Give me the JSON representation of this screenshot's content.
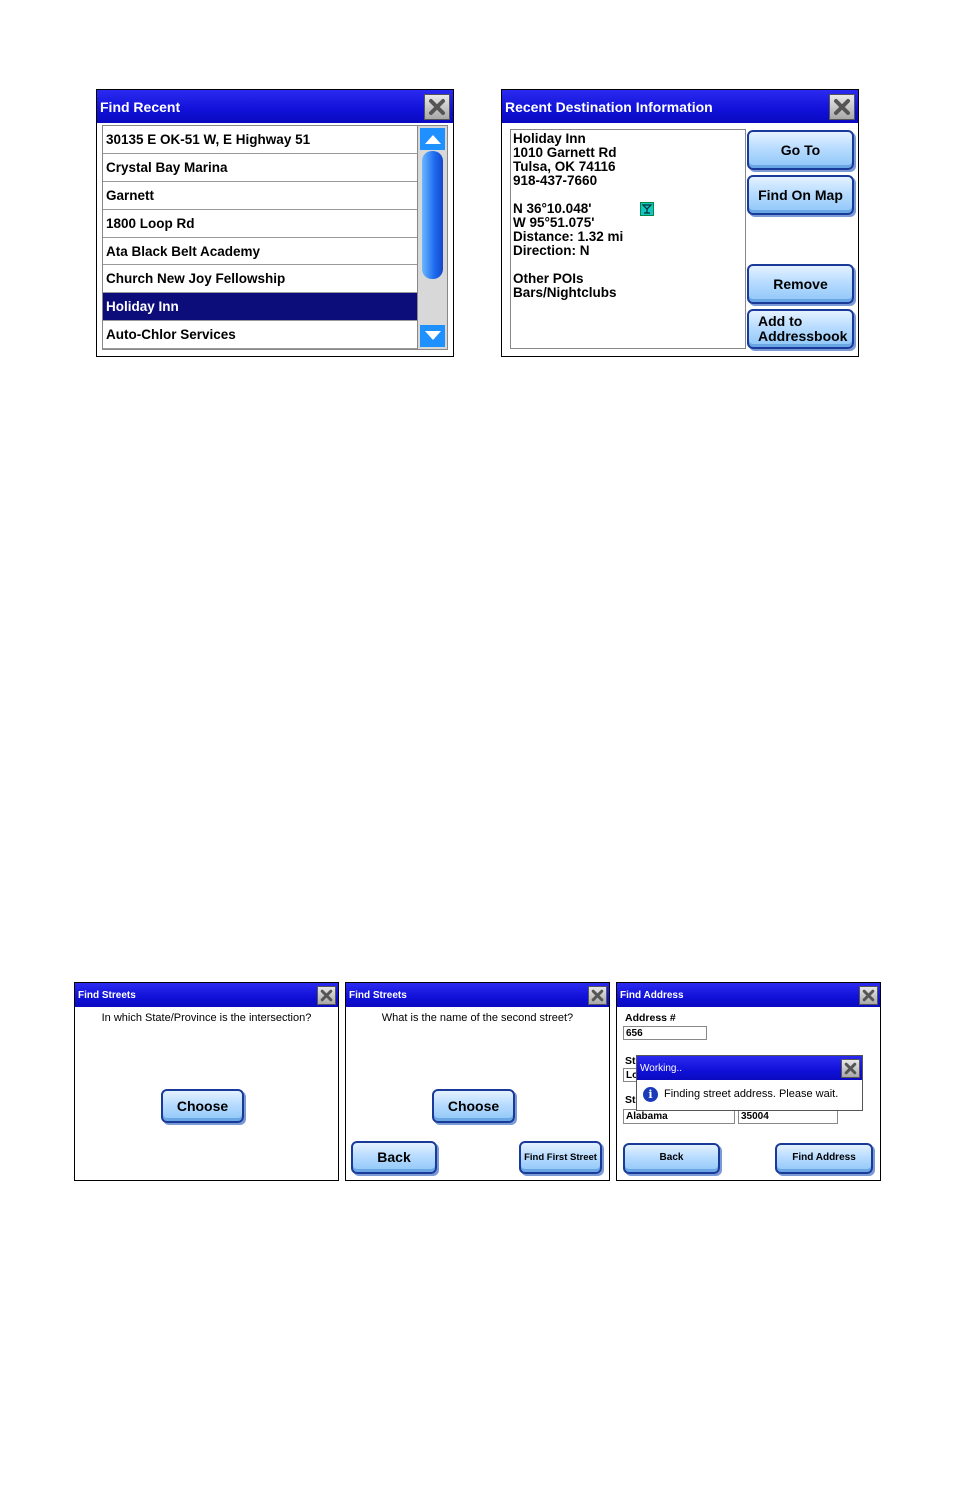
{
  "find_recent": {
    "title": "Find Recent",
    "items": [
      "30135 E OK-51 W, E Highway 51",
      "Crystal Bay Marina",
      "Garnett",
      "1800 Loop Rd",
      "Ata Black Belt Academy",
      "Church New Joy Fellowship",
      "Holiday Inn",
      "Auto-Chlor Services"
    ],
    "selected_index": 6
  },
  "recent_dest": {
    "title": "Recent Destination Information",
    "lines": [
      "Holiday Inn",
      "1010 Garnett Rd",
      "Tulsa, OK 74116",
      "918-437-7660",
      "",
      "N   36°10.048'",
      "W   95°51.075'",
      "Distance:  1.32  mi",
      "Direction:  N",
      "",
      "Other POIs",
      "Bars/Nightclubs"
    ],
    "buttons": {
      "go_to": "Go To",
      "find_on_map": "Find On Map",
      "remove": "Remove",
      "add_to_addressbook_1": "Add  to",
      "add_to_addressbook_2": "Addressbook"
    },
    "poi_icon": "cocktail-glass-icon"
  },
  "find_streets_1": {
    "title": "Find Streets",
    "question": "In  which  State/Province  is  the  intersection?",
    "choose": "Choose"
  },
  "find_streets_2": {
    "title": "Find Streets",
    "question": "What  is  the  name  of  the  second  street?",
    "choose": "Choose",
    "back": "Back",
    "find_first_street": "Find First Street"
  },
  "find_address": {
    "title": "Find Address",
    "address_label": "Address  #",
    "address_value": "656",
    "street_label_1": "St",
    "street_label_2": "St",
    "street_partial": "Lo",
    "state_value": "Alabama",
    "zip_value": "35004",
    "back": "Back",
    "find_address": "Find Address",
    "working_dialog": {
      "title": "Working..",
      "message": "Finding  street  address.   Please  wait.",
      "icon": "info-icon"
    }
  },
  "colors": {
    "title_bar": "#1414e0",
    "selection": "#0c0c7a",
    "button_fill": "#b8dcff",
    "scroll_accent": "#1e90ff"
  }
}
